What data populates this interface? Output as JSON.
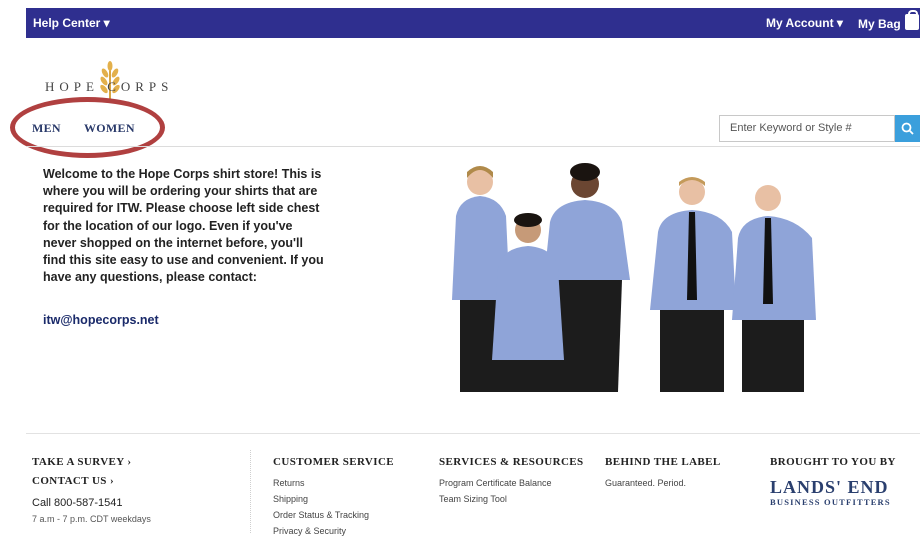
{
  "topbar": {
    "help_label": "Help Center ▾",
    "account_label": "My Account ▾",
    "bag_label": "My Bag"
  },
  "logo": {
    "text": "HOPE CORPS"
  },
  "nav": {
    "items": [
      "MEN",
      "WOMEN"
    ]
  },
  "search": {
    "placeholder": "Enter Keyword or Style #"
  },
  "intro": {
    "text": "Welcome to the Hope Corps shirt store! This is where you will be ordering your shirts that are required for ITW. Please choose left side chest for the location of our logo. Even if you've never shopped on the internet before, you'll find this site easy to use and convenient. If you have any questions, please contact:",
    "email": "itw@hopecorps.net"
  },
  "footer": {
    "survey": "TAKE A SURVEY ›",
    "contact": "CONTACT US ›",
    "phone": "Call 800-587-1541",
    "hours": "7 a.m - 7 p.m. CDT weekdays",
    "customer_service": {
      "title": "CUSTOMER SERVICE",
      "links": [
        "Returns",
        "Shipping",
        "Order Status & Tracking",
        "Privacy & Security"
      ]
    },
    "services": {
      "title": "SERVICES & RESOURCES",
      "links": [
        "Program Certificate Balance",
        "Team Sizing Tool"
      ]
    },
    "behind": {
      "title": "BEHIND THE LABEL",
      "links": [
        "Guaranteed. Period."
      ]
    },
    "brought": {
      "title": "BROUGHT TO YOU BY",
      "logo": "LANDS' END",
      "sub": "BUSINESS OUTFITTERS"
    }
  },
  "colors": {
    "topbar": "#2f2f8f",
    "search_button": "#3b9fdc",
    "annotation_circle": "#b04040"
  }
}
